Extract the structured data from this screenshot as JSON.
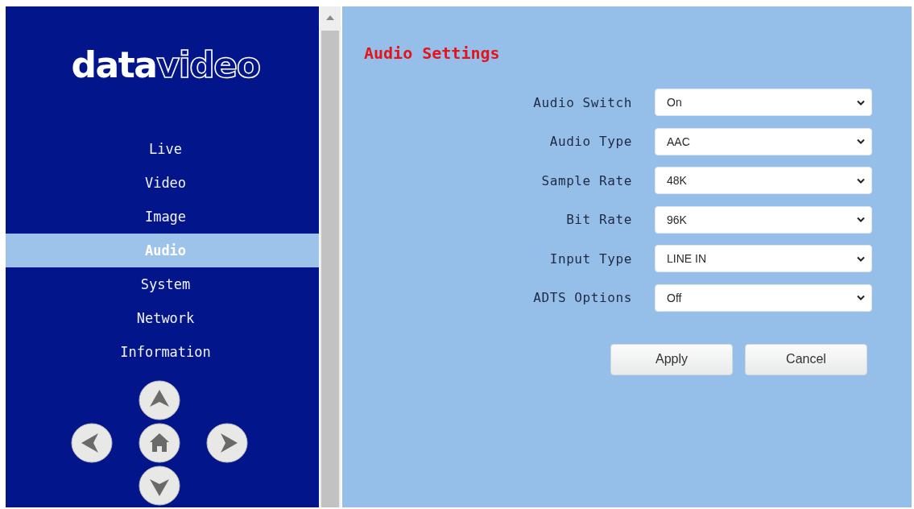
{
  "sidebar": {
    "logo": "**data**video",
    "nav": [
      {
        "label": "Live",
        "selected": false
      },
      {
        "label": "Video",
        "selected": false
      },
      {
        "label": "Image",
        "selected": false
      },
      {
        "label": "Audio",
        "selected": true
      },
      {
        "label": "System",
        "selected": false
      },
      {
        "label": "Network",
        "selected": false
      },
      {
        "label": "Information",
        "selected": false
      }
    ]
  },
  "main": {
    "title": "Audio Settings",
    "fields": [
      {
        "label": "Audio Switch",
        "value": "On"
      },
      {
        "label": "Audio Type",
        "value": "AAC"
      },
      {
        "label": "Sample Rate",
        "value": "48K"
      },
      {
        "label": "Bit Rate",
        "value": "96K"
      },
      {
        "label": "Input Type",
        "value": "LINE IN"
      },
      {
        "label": "ADTS Options",
        "value": "Off"
      }
    ],
    "buttons": [
      "Apply",
      "Cancel"
    ]
  }
}
